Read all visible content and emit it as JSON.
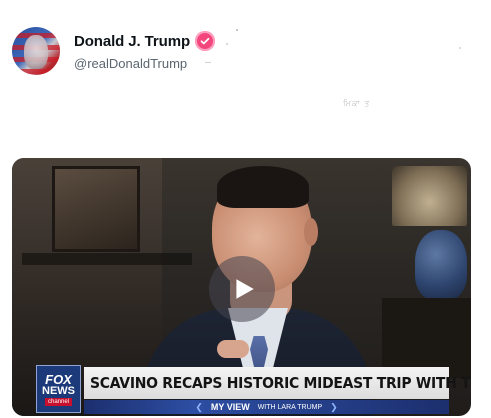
{
  "post": {
    "author": {
      "display_name": "Donald J. Trump",
      "handle": "@realDonaldTrump",
      "verified": true,
      "verified_color": "#f2467c"
    },
    "faint_text": "ਮਿਕਾ ਤ"
  },
  "video": {
    "news_logo": {
      "line1": "FOX",
      "line2": "NEWS",
      "line3": "channel"
    },
    "headline": "SCAVINO RECAPS HISTORIC MIDEAST TRIP WITH TRUMP",
    "show": {
      "title": "MY VIEW",
      "with": "WITH LARA TRUMP"
    },
    "play_icon": "play-icon"
  },
  "colors": {
    "text_primary": "#0f1419",
    "text_secondary": "#5b6670",
    "fox_blue": "#1c3a7a",
    "fox_red": "#c8102e"
  }
}
